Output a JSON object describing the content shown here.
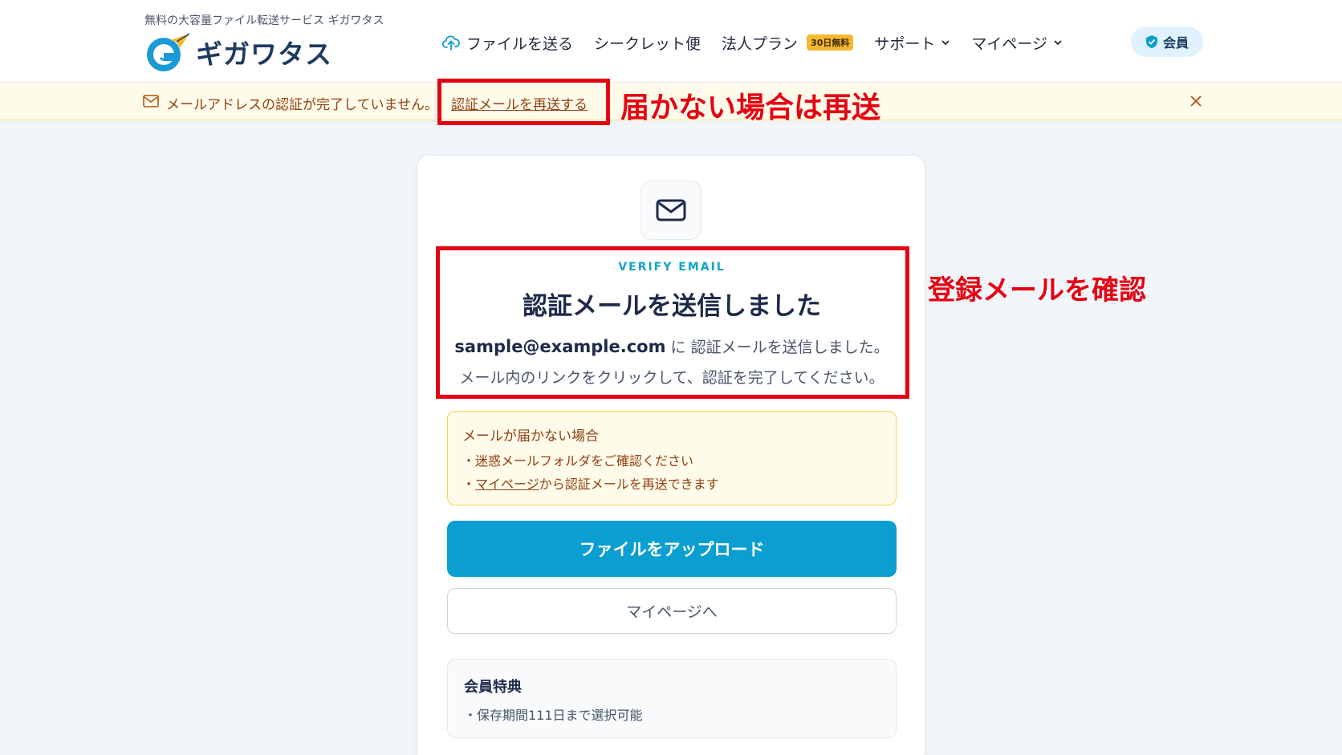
{
  "header": {
    "tagline": "無料の大容量ファイル転送サービス ギガワタス",
    "logo_text": "ギガワタス",
    "nav": [
      {
        "label": "ファイルを送る",
        "icon": "upload-cloud-icon"
      },
      {
        "label": "シークレット便"
      },
      {
        "label": "法人プラン",
        "badge": "30日無料"
      },
      {
        "label": "サポート",
        "icon": "chevron-down-icon"
      },
      {
        "label": "マイページ",
        "icon": "chevron-down-icon"
      }
    ],
    "member_label": "会員"
  },
  "notice": {
    "text": "メールアドレスの認証が完了していません。",
    "link": "認証メールを再送する"
  },
  "annotations": {
    "resend": "届かない場合は再送",
    "confirm": "登録メールを確認"
  },
  "card": {
    "eyebrow": "VERIFY EMAIL",
    "title": "認証メールを送信しました",
    "email": "sample@example.com",
    "sent_suffix": " に 認証メールを送信しました。",
    "instruction": "メール内のリンクをクリックして、認証を完了してください。",
    "warning": {
      "title": "メールが届かない場合",
      "item1": "・迷惑メールフォルダをご確認ください",
      "item2_prefix": "・",
      "item2_link": "マイページ",
      "item2_suffix": "から認証メールを再送できます"
    },
    "primary_button": "ファイルをアップロード",
    "secondary_button": "マイページへ",
    "benefits": {
      "title": "会員特典",
      "item": "・保存期間111日まで選択可能"
    }
  },
  "colors": {
    "accent": "#0b9ed0",
    "annotation": "#e60012",
    "warning_bg": "#fffbeb",
    "warning_text": "#92400e"
  }
}
